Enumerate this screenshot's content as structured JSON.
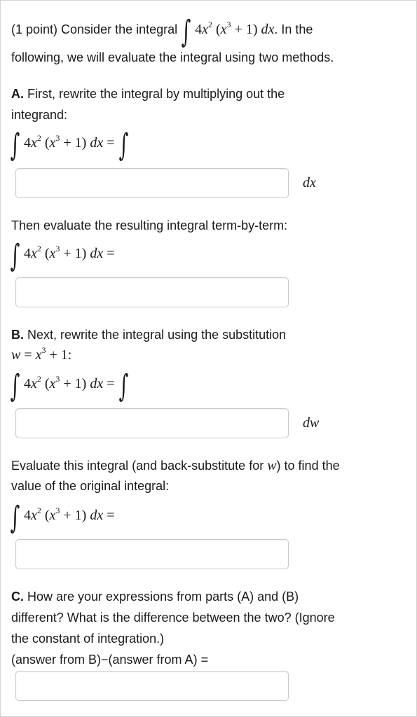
{
  "intro": {
    "prefix": "(1 point) Consider the integral",
    "suffix": ". In the",
    "line2": "following, we will evaluate the integral using two methods."
  },
  "integrand": {
    "coef": "4",
    "x": "x",
    "exp2": "2",
    "paren_open": "(",
    "x3": "x",
    "exp3": "3",
    "plus_one": " + 1)",
    "dx": " dx",
    "equals": "="
  },
  "part_a": {
    "label": "A.",
    "text1": " First, rewrite the integral by multiplying out the",
    "text2": "integrand:",
    "unit": "dx",
    "text3": "Then evaluate the resulting integral term-by-term:"
  },
  "part_b": {
    "label": "B.",
    "text1": " Next, rewrite the integral using the substitution",
    "sub_w": "w",
    "sub_eq": " = ",
    "sub_x": "x",
    "sub_exp": "3",
    "sub_tail": " + 1:",
    "unit": "dw",
    "text2a": "Evaluate this integral (and back-substitute for ",
    "text2w": "w",
    "text2b": ") to find the",
    "text3": "value of the original integral:"
  },
  "part_c": {
    "label": "C.",
    "text1": " How are your expressions from parts (A) and (B)",
    "text2": "different? What is the difference between the two? (Ignore",
    "text3": "the constant of integration.)",
    "text4": "(answer from B)−(answer from A) ="
  }
}
